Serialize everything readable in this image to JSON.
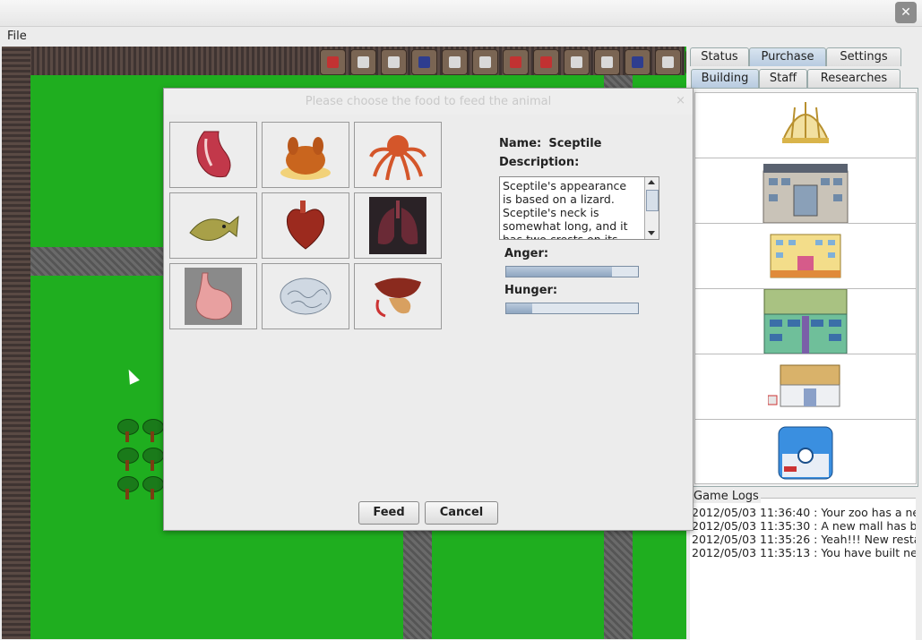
{
  "window": {
    "close_symbol": "✕"
  },
  "menu": {
    "file": "File"
  },
  "map": {
    "top_icons": [
      "red",
      "grey",
      "grey",
      "blue",
      "grey",
      "grey",
      "red",
      "red",
      "grey",
      "grey",
      "blue",
      "grey",
      "grey"
    ]
  },
  "tabs": {
    "main": [
      "Status",
      "Purchase",
      "Settings"
    ],
    "main_selected": "Purchase",
    "sub": [
      "Building",
      "Staff",
      "Researches"
    ],
    "sub_selected": "Building"
  },
  "buildings": [
    "dome-building",
    "station-building",
    "hotel-building",
    "mall-building",
    "shop-building",
    "pokecenter-building"
  ],
  "logs": {
    "title": "Game Logs",
    "entries": [
      "2012/05/03 11:36:40 : Your zoo has a ne",
      "2012/05/03 11:35:30 : A new mall has be",
      "2012/05/03 11:35:26 : Yeah!!! New resta",
      "2012/05/03 11:35:13 : You have built ne"
    ]
  },
  "dialog": {
    "title": "Please choose the food to feed the animal",
    "close": "×",
    "foods": [
      "meat-icon",
      "roast-chicken-icon",
      "octopus-icon",
      "fish-icon",
      "heart-icon",
      "lungs-icon",
      "stomach-icon",
      "brain-icon",
      "liver-icon"
    ],
    "name_label": "Name:",
    "name_value": "Sceptile",
    "description_label": "Description:",
    "description": "Sceptile's appearance is based on a lizard. Sceptile's neck is somewhat long, and it has two crests on its",
    "anger_label": "Anger:",
    "anger_level": 0.8,
    "hunger_label": "Hunger:",
    "hunger_level": 0.2,
    "feed_button": "Feed",
    "cancel_button": "Cancel"
  }
}
